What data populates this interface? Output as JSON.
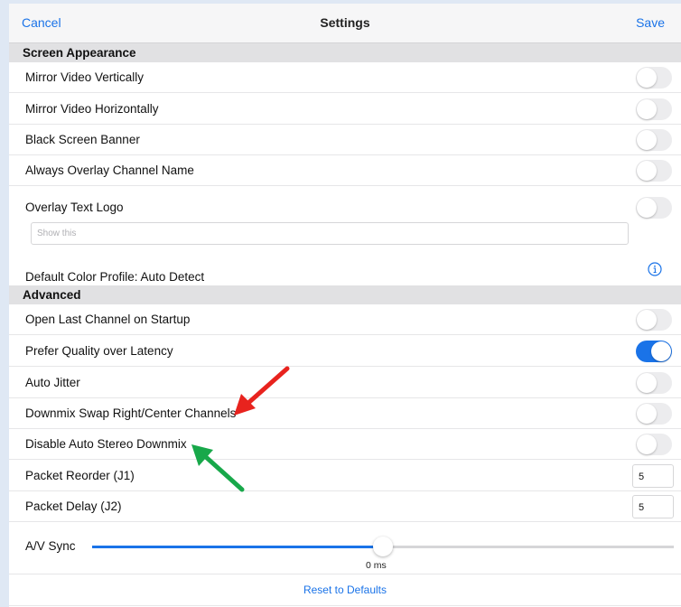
{
  "colors": {
    "accent": "#1a73e8",
    "arrow_red": "#e8231e",
    "arrow_green": "#18a84a"
  },
  "navbar": {
    "cancel_label": "Cancel",
    "title": "Settings",
    "save_label": "Save"
  },
  "screen_appearance": {
    "header": "Screen Appearance",
    "items": [
      {
        "label": "Mirror Video Vertically",
        "on": false
      },
      {
        "label": "Mirror Video Horizontally",
        "on": false
      },
      {
        "label": "Black Screen Banner",
        "on": false
      },
      {
        "label": "Always Overlay Channel Name",
        "on": false
      },
      {
        "label": "Overlay Text Logo",
        "on": false
      }
    ],
    "overlay_text_placeholder": "Show this",
    "color_profile_label": "Default Color Profile:  Auto Detect",
    "info_icon": "info-icon"
  },
  "advanced": {
    "header": "Advanced",
    "items": [
      {
        "label": "Open Last Channel on Startup",
        "on": false
      },
      {
        "label": "Prefer Quality over Latency",
        "on": true
      },
      {
        "label": "Auto Jitter",
        "on": false
      },
      {
        "label": "Downmix Swap Right/Center Channels",
        "on": false
      },
      {
        "label": "Disable Auto Stereo Downmix",
        "on": false
      }
    ],
    "packet_reorder": {
      "label": "Packet Reorder (J1)",
      "value": "5"
    },
    "packet_delay": {
      "label": "Packet Delay (J2)",
      "value": "5"
    },
    "av_sync": {
      "label": "A/V Sync",
      "value_text": "0 ms",
      "level": 0.5
    },
    "reset_label": "Reset to Defaults"
  },
  "annotations": [
    {
      "icon": "red-arrow-icon",
      "points_to": "Downmix Swap Right/Center Channels"
    },
    {
      "icon": "green-arrow-icon",
      "points_to": "Disable Auto Stereo Downmix"
    }
  ]
}
